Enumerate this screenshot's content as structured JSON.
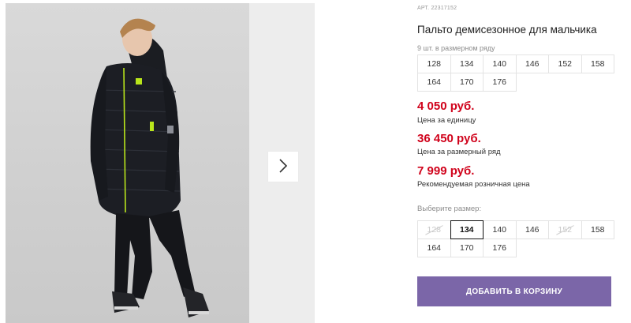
{
  "product": {
    "sku_label": "АРТ.",
    "sku_value": "22317152",
    "title": "Пальто демисезонное для мальчика",
    "image_alt": "Мальчик в черном пальто"
  },
  "gallery": {
    "next_icon": "chevron-right-icon"
  },
  "pack": {
    "caption": "9 шт. в размерном ряду",
    "sizes": [
      "128",
      "134",
      "140",
      "146",
      "152",
      "158",
      "164",
      "170",
      "176"
    ]
  },
  "prices": {
    "unit_price": "4 050 руб.",
    "unit_note": "Цена за единицу",
    "pack_price": "36 450 руб.",
    "pack_note": "Цена за размерный ряд",
    "retail_price": "7 999 руб.",
    "retail_note": "Рекомендуемая розничная цена"
  },
  "size_select": {
    "caption": "Выберите размер:",
    "sizes": [
      {
        "label": "128",
        "state": "disabled"
      },
      {
        "label": "134",
        "state": "selected"
      },
      {
        "label": "140",
        "state": "available"
      },
      {
        "label": "146",
        "state": "available"
      },
      {
        "label": "152",
        "state": "disabled"
      },
      {
        "label": "158",
        "state": "available"
      },
      {
        "label": "164",
        "state": "available"
      },
      {
        "label": "170",
        "state": "available"
      },
      {
        "label": "176",
        "state": "available"
      }
    ]
  },
  "cart": {
    "button_label": "ДОБАВИТЬ В КОРЗИНУ"
  },
  "colors": {
    "price_red": "#d0021b",
    "cart_purple": "#7b66a8",
    "coat_black": "#1b1d22",
    "accent_green": "#b9e51b"
  }
}
